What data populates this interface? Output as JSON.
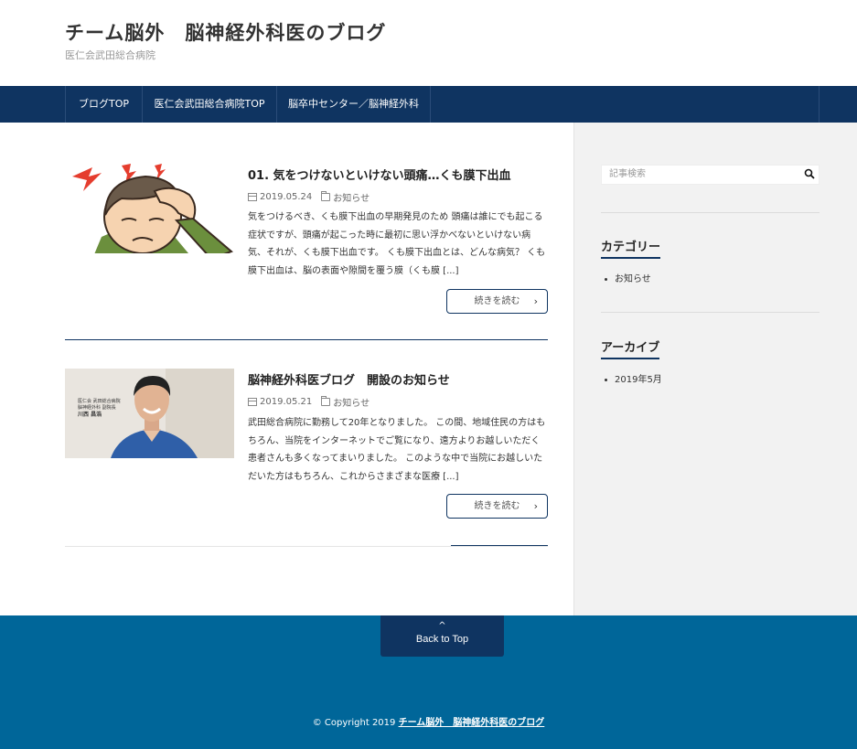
{
  "site": {
    "title": "チーム脳外　脳神経外科医のブログ",
    "description": "医仁会武田総合病院"
  },
  "nav": {
    "items": [
      {
        "label": "ブログTOP"
      },
      {
        "label": "医仁会武田総合病院TOP"
      },
      {
        "label": "脳卒中センター／脳神経外科"
      }
    ]
  },
  "posts": [
    {
      "title": "01. 気をつけないといけない頭痛…くも膜下出血",
      "date": "2019.05.24",
      "category": "お知らせ",
      "excerpt": "気をつけるべき、くも膜下出血の早期発見のため 頭痛は誰にでも起こる症状ですが、頭痛が起こった時に最初に思い浮かべないといけない病気、それが、くも膜下出血です。 くも膜下出血とは、どんな病気？ くも膜下出血は、脳の表面や隙間を覆う膜（くも膜 [...]",
      "more_label": "続きを読む",
      "thumb_icon": "headache-illustration"
    },
    {
      "title": "脳神経外科医ブログ　開設のお知らせ",
      "date": "2019.05.21",
      "category": "お知らせ",
      "excerpt": "武田総合病院に勤務して20年となりました。 この間、地域住民の方はもちろん、当院をインターネットでご覧になり、遠方よりお越しいただく患者さんも多くなってまいりました。 このような中で当院にお越しいただいた方はもちろん、これからさまざまな医療 [...]",
      "more_label": "続きを読む",
      "thumb_icon": "doctor-photo",
      "thumb_caption": {
        "line1": "医仁会 武田総合病院",
        "line2": "脳神経外科 副院長",
        "name": "川西 昌浩"
      }
    }
  ],
  "sidebar": {
    "search_placeholder": "記事検索",
    "categories_title": "カテゴリー",
    "categories": [
      "お知らせ"
    ],
    "archives_title": "アーカイブ",
    "archives": [
      "2019年5月"
    ]
  },
  "footer": {
    "back_to_top": "Back to Top",
    "copyright_prefix": "© Copyright 2019",
    "copyright_link": "チーム脳外　脳神経外科医のブログ"
  },
  "colors": {
    "nav": "#0f3461",
    "footer": "#006699",
    "sidebar_bg": "#f2f2f2"
  }
}
